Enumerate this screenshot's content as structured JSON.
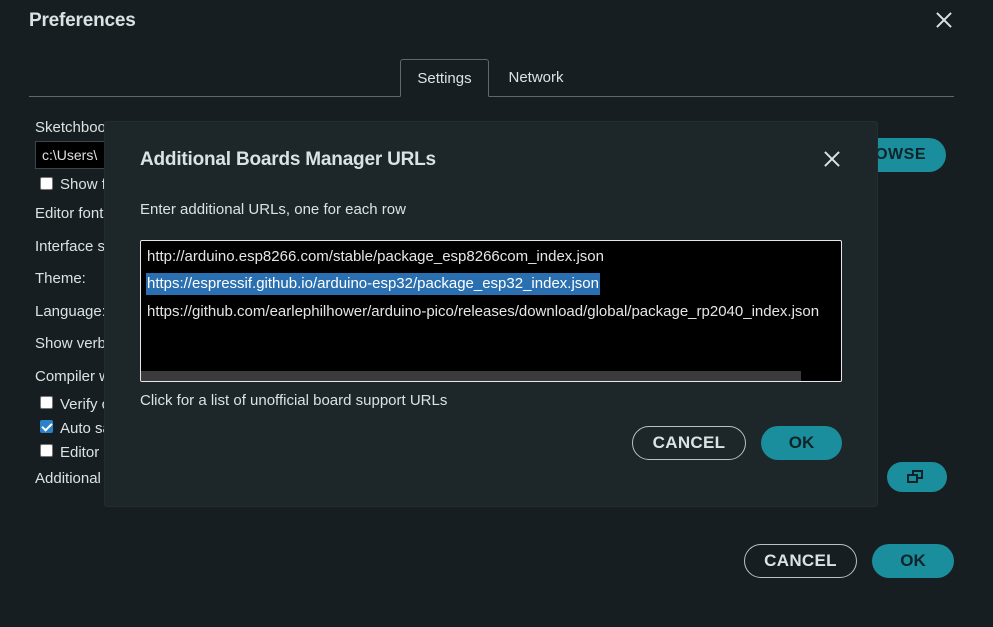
{
  "window": {
    "title": "Preferences"
  },
  "tabs": [
    {
      "label": "Settings",
      "active": true
    },
    {
      "label": "Network",
      "active": false
    }
  ],
  "background": {
    "sketchbook_label": "Sketchbook location:",
    "sketchbook_path": "c:\\Users\\",
    "show_files_label": "Show files inside Sketches",
    "editor_font_label": "Editor font size:",
    "interface_scale_label": "Interface scale:",
    "theme_label": "Theme:",
    "language_label": "Language:",
    "show_verbose_label": "Show verbose output during",
    "compiler_label": "Compiler warnings",
    "verify_label": "Verify code after upload",
    "auto_save_label": "Auto save",
    "editor_label": "Editor Quick Suggestions",
    "additional_label": "Additional boards manager URLs",
    "browse_label": "BROWSE",
    "cancel_label": "CANCEL",
    "ok_label": "OK"
  },
  "dialog": {
    "title": "Additional Boards Manager URLs",
    "instruction": "Enter additional URLs, one for each row",
    "urls": [
      "http://arduino.esp8266.com/stable/package_esp8266com_index.json",
      "https://espressif.github.io/arduino-esp32/package_esp32_index.json",
      "https://github.com/earlephilhower/arduino-pico/releases/download/global/package_rp2040_index.json"
    ],
    "selected_url_index": 1,
    "link_text": "Click for a list of unofficial board support URLs",
    "cancel_label": "CANCEL",
    "ok_label": "OK"
  },
  "colors": {
    "background": "#171e21",
    "dialog": "#1d2629",
    "accent": "#1a8e9c",
    "selection": "#2a6fb0"
  }
}
